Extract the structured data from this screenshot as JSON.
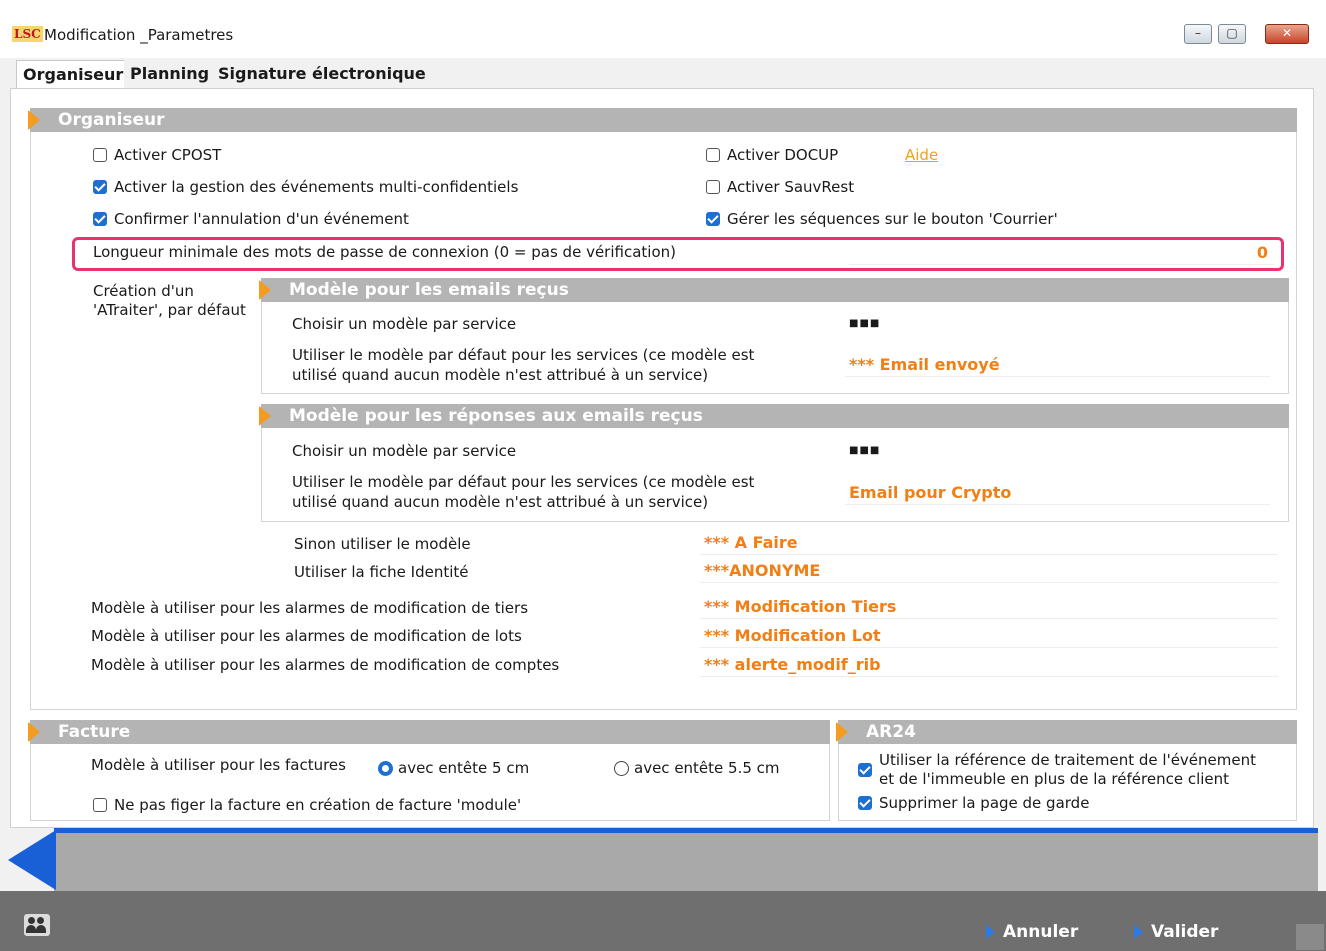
{
  "window": {
    "app_icon": "LSC",
    "title": "Modification _Parametres",
    "minimize": "–",
    "maximize": "▢",
    "close": "✕"
  },
  "tabs": [
    {
      "label": "Organiseur",
      "active": true
    },
    {
      "label": "Planning",
      "active": false
    },
    {
      "label": "Signature électronique",
      "active": false
    }
  ],
  "organiseur": {
    "header": "Organiseur",
    "activer_cpost": {
      "label": "Activer CPOST",
      "checked": false
    },
    "activer_docup": {
      "label": "Activer DOCUP",
      "checked": false
    },
    "aide_link": "Aide",
    "multi_confidentiels": {
      "label": "Activer la gestion des événements multi-confidentiels",
      "checked": true
    },
    "activer_sauvrest": {
      "label": "Activer SauvRest",
      "checked": false
    },
    "confirmer_annulation": {
      "label": "Confirmer l'annulation d'un événement",
      "checked": true
    },
    "gerer_sequences": {
      "label": "Gérer les séquences sur le bouton 'Courrier'",
      "checked": true
    },
    "longueur_min": {
      "label": "Longueur minimale des mots de passe de connexion (0 = pas de vérification)",
      "value": "0"
    },
    "creation_label_1": "Création d'un",
    "creation_label_2": "'ATraiter', par défaut",
    "emails_recus": {
      "header": "Modèle pour les emails reçus",
      "choisir_label": "Choisir un modèle par service",
      "choisir_value": "■■■",
      "defaut_label_1": "Utiliser le modèle par défaut pour les services (ce modèle est",
      "defaut_label_2": "utilisé quand aucun modèle n'est attribué à un service)",
      "defaut_value": "*** Email envoyé"
    },
    "reponses_emails": {
      "header": "Modèle pour les réponses aux emails reçus",
      "choisir_label": "Choisir un modèle par service",
      "choisir_value": "■■■",
      "defaut_label_1": "Utiliser le modèle par défaut pour les services (ce modèle est",
      "defaut_label_2": "utilisé quand aucun modèle n'est attribué à un service)",
      "defaut_value": "Email pour Crypto"
    },
    "sinon_label": "Sinon utiliser le modèle",
    "sinon_value": "*** A Faire",
    "fiche_label": "Utiliser la fiche Identité",
    "fiche_value": "***ANONYME",
    "alarme_tiers_label": "Modèle à utiliser pour les alarmes de modification de tiers",
    "alarme_tiers_value": "*** Modification Tiers",
    "alarme_lots_label": "Modèle à utiliser pour les alarmes de modification de lots",
    "alarme_lots_value": "*** Modification Lot",
    "alarme_comptes_label": "Modèle à utiliser pour les alarmes de modification de comptes",
    "alarme_comptes_value": "*** alerte_modif_rib"
  },
  "facture": {
    "header": "Facture",
    "modele_label": "Modèle à utiliser pour les factures",
    "option_5": {
      "label": "avec entête 5 cm",
      "selected": true
    },
    "option_55": {
      "label": "avec entête 5.5 cm",
      "selected": false
    },
    "ne_pas_figer": {
      "label": "Ne pas figer la facture en création de facture 'module'",
      "checked": false
    }
  },
  "ar24": {
    "header": "AR24",
    "reference": {
      "label_1": "Utiliser la référence de traitement de l'événement",
      "label_2": "et de l'immeuble en plus de la référence client",
      "checked": true
    },
    "supprimer_garde": {
      "label": "Supprimer la page de garde",
      "checked": true
    }
  },
  "footer": {
    "annuler": "Annuler",
    "valider": "Valider",
    "users_icon": "users-icon"
  },
  "colors": {
    "accent_orange": "#f07f16",
    "highlight_border": "#e8336d",
    "blue_bar": "#1960d6"
  }
}
